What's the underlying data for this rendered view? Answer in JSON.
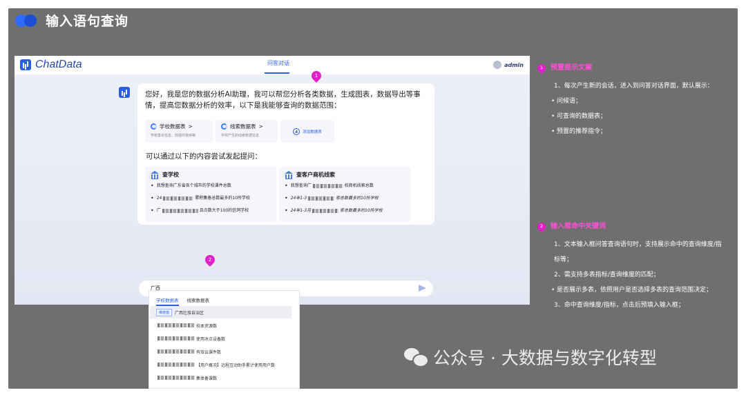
{
  "slide": {
    "title": "输入语句查询"
  },
  "app": {
    "brand": "ChatData",
    "tab_active": "问答对话",
    "user": "admin",
    "greeting": "您好，我是您的数据分析AI助理，我可以帮您分析各类数据，生成图表，数据导出等事情，提高您数据分析的效率，以下是我能够查询的数据范围：",
    "db_cards": [
      {
        "title": "学校数据表",
        "arrow": ">",
        "desc": "学校基本信息、软硬件使用等"
      },
      {
        "title": "线索数据表",
        "arrow": ">",
        "desc": "学校产生的线索数据信息"
      }
    ],
    "add_table": "添加数据表",
    "ask_prompt": "可以通过以下的内容尝试发起提问：",
    "suggest_left": {
      "title": "查学校",
      "items": [
        {
          "pre": "我想查询广东省各个城市的学校课件总数",
          "post": ""
        },
        {
          "pre": "24",
          "post": "累积集备总数最多的10所学校"
        },
        {
          "pre": "广",
          "post": "且点数大于100的信鸽学校"
        }
      ]
    },
    "suggest_right": {
      "title": "查客户商机线索",
      "items": [
        {
          "pre": "我想查询广",
          "post": "校商机线索总数"
        },
        {
          "pre": "24年1-3",
          "post": "索总数最多的10所学校"
        },
        {
          "pre": "24年1-3月",
          "post": "索总数最多的10所学校"
        }
      ]
    },
    "input_value": "广西",
    "dropdown": {
      "tabs": [
        "学校数据表",
        "线索数据表"
      ],
      "selected_tag": "维度值",
      "selected_value": "广西壮族自治区",
      "rows": [
        "校本资源数",
        "使用冰点设备数",
        "有效云课件数",
        "【用户概况】远程互动助手累计使用用户数",
        "集体备课数"
      ]
    }
  },
  "markers": {
    "m1": "1",
    "m2": "2"
  },
  "notes": {
    "section1": {
      "num": "1",
      "title": "预置提示文案",
      "lines": [
        "1、每次产生新的会话，进入到问答对话界面，默认展示："
      ],
      "bullets": [
        "问候语；",
        "可查询的数据表；",
        "预置的推荐指令；"
      ]
    },
    "section2": {
      "num": "2",
      "title": "输入框命中关键词",
      "line1": "1、文本输入框问答查询语句时，支持展示命中的查询维度/指标等；",
      "line2": "2、需支持多表指标/查询维度的匹配；",
      "bullet": "是否展示多表，依照用户是否选择多表的查询范围决定；",
      "line3": "3、命中查询维度/指标，点击后预填入输入框；"
    }
  },
  "watermark": "公众号 · 大数据与数字化转型"
}
